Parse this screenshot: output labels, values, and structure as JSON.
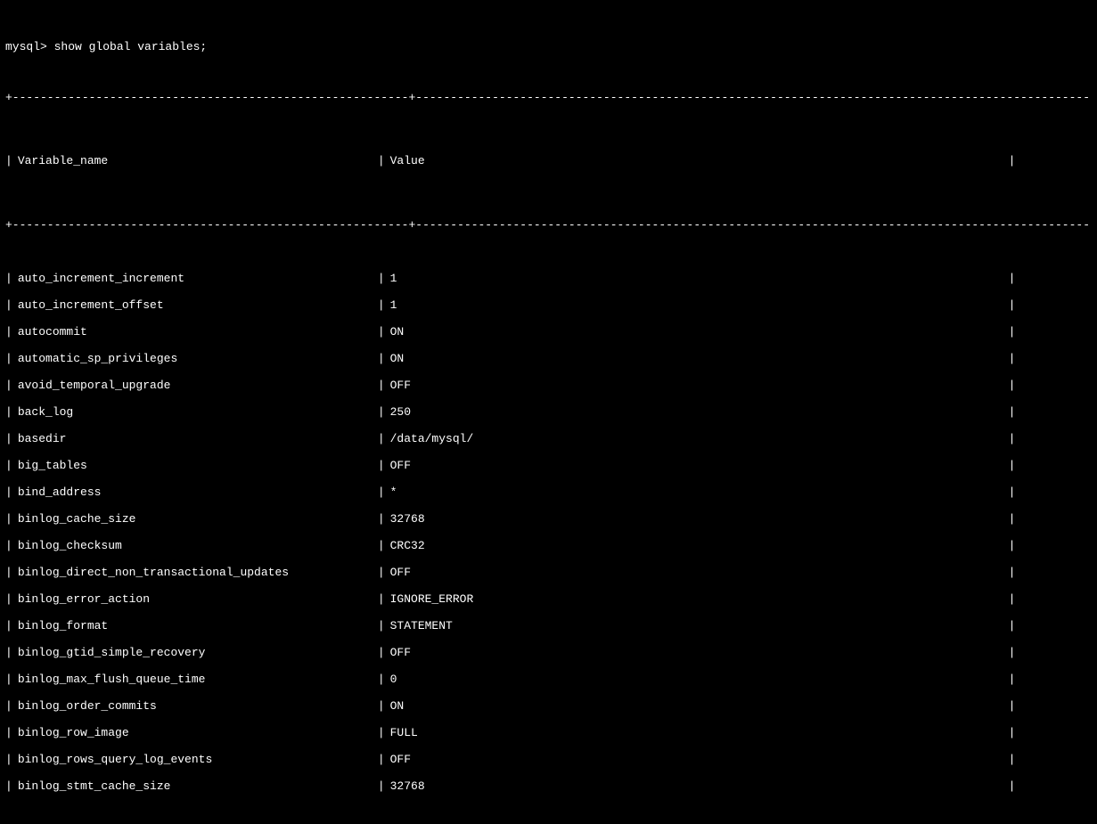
{
  "prompt": "mysql> show global variables;",
  "header": {
    "name": "Variable_name",
    "value": "Value"
  },
  "rows": [
    {
      "name": "auto_increment_increment",
      "value": "1"
    },
    {
      "name": "auto_increment_offset",
      "value": "1"
    },
    {
      "name": "autocommit",
      "value": "ON"
    },
    {
      "name": "automatic_sp_privileges",
      "value": "ON"
    },
    {
      "name": "avoid_temporal_upgrade",
      "value": "OFF"
    },
    {
      "name": "back_log",
      "value": "250"
    },
    {
      "name": "basedir",
      "value": "/data/mysql/"
    },
    {
      "name": "big_tables",
      "value": "OFF"
    },
    {
      "name": "bind_address",
      "value": "*"
    },
    {
      "name": "binlog_cache_size",
      "value": "32768"
    },
    {
      "name": "binlog_checksum",
      "value": "CRC32"
    },
    {
      "name": "binlog_direct_non_transactional_updates",
      "value": "OFF"
    },
    {
      "name": "binlog_error_action",
      "value": "IGNORE_ERROR"
    },
    {
      "name": "binlog_format",
      "value": "STATEMENT"
    },
    {
      "name": "binlog_gtid_simple_recovery",
      "value": "OFF"
    },
    {
      "name": "binlog_max_flush_queue_time",
      "value": "0"
    },
    {
      "name": "binlog_order_commits",
      "value": "ON"
    },
    {
      "name": "binlog_row_image",
      "value": "FULL"
    },
    {
      "name": "binlog_rows_query_log_events",
      "value": "OFF"
    },
    {
      "name": "binlog_stmt_cache_size",
      "value": "32768"
    }
  ],
  "border": {
    "seg1": "+---------------------------------------------------------+",
    "seg2": "----------------------------------------------------------------------------------------------------------+"
  },
  "pipe": "|"
}
